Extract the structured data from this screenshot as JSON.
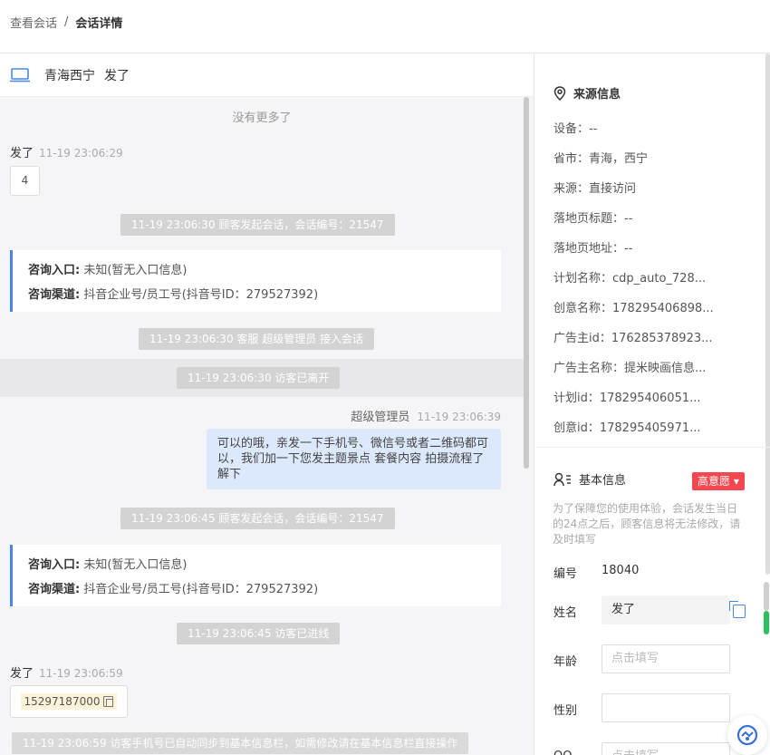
{
  "breadcrumb": {
    "parent": "查看会话",
    "separator": "/",
    "current": "会话详情"
  },
  "conversation": {
    "location": "青海西宁",
    "visitor": "发了"
  },
  "messages": {
    "no_more": "没有更多了",
    "m1": {
      "sender": "发了",
      "time": "11-19 23:06:29",
      "content": "4"
    },
    "sys1": "11-19 23:06:30 顾客发起会话，会话编号：21547",
    "card1": {
      "entry_label": "咨询入口:",
      "entry_value": "未知(暂无入口信息)",
      "channel_label": "咨询渠道:",
      "channel_value": "抖音企业号/员工号(抖音号ID：279527392)"
    },
    "sys2": "11-19 23:06:30 客服 超级管理员 接入会话",
    "sys3": "11-19 23:06:30 访客已离开",
    "m2": {
      "sender": "超级管理员",
      "time": "11-19 23:06:39",
      "content": "可以的哦，亲发一下手机号、微信号或者二维码都可以，我们加一下您发主题景点 套餐内容 拍摄流程了解下"
    },
    "sys4": "11-19 23:06:45 顾客发起会话，会话编号：21547",
    "card2": {
      "entry_label": "咨询入口:",
      "entry_value": "未知(暂无入口信息)",
      "channel_label": "咨询渠道:",
      "channel_value": "抖音企业号/员工号(抖音号ID：279527392)"
    },
    "sys5": "11-19 23:06:45 访客已进线",
    "m3": {
      "sender": "发了",
      "time": "11-19 23:06:59",
      "content": "15297187000"
    },
    "sys6": "11-19 23:06:59 访客手机号已自动同步到基本信息栏，如需修改请在基本信息栏直接操作"
  },
  "source_info": {
    "title": "来源信息",
    "device": "设备：--",
    "province": "省市：青海，西宁",
    "source": "来源：直接访问",
    "landing_title": "落地页标题：--",
    "landing_url": "落地页地址：--",
    "plan_name": "计划名称：cdp_auto_728...",
    "creative_name": "创意名称：178295406898...",
    "advertiser_id": "广告主id：176285378923...",
    "advertiser_name": "广告主名称：提米映画信息...",
    "plan_id": "计划id：178295406051...",
    "creative_id": "创意id：178295405971..."
  },
  "basic_info": {
    "title": "基本信息",
    "intent_badge": "高意愿 ▾",
    "hint": "为了保障您的使用体验，会话发生当日的24点之后，顾客信息将无法修改，请及时填写",
    "id_label": "编号",
    "id_value": "18040",
    "name_label": "姓名",
    "name_value": "发了",
    "age_label": "年龄",
    "age_placeholder": "点击填写",
    "gender_label": "性别",
    "qq_label": "QQ",
    "qq_placeholder": "点击填写"
  },
  "colors": {
    "accent": "#4a86e8",
    "badge": "#f5474f",
    "bubble_right": "#dce8fb"
  }
}
